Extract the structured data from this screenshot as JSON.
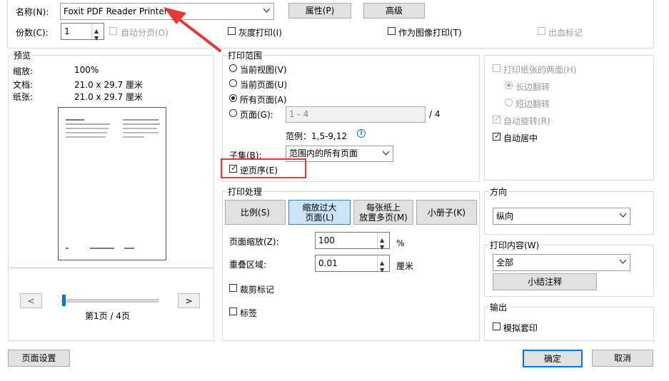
{
  "printer": {
    "name_label": "名称(N):",
    "name_value": "Foxit PDF Reader Printer",
    "properties_button": "属性(P)",
    "advanced_button": "高级",
    "copies_label": "份数(C):",
    "copies_value": "1",
    "collate_label": "自动分页(O)",
    "grayscale_label": "灰度打印(I)",
    "as_image_label": "作为图像打印(T)",
    "bleed_label": "出血标记"
  },
  "preview": {
    "title": "预览",
    "zoom_label": "缩放:",
    "zoom_value": "100%",
    "document_label": "文档:",
    "document_value": "21.0 x 29.7 厘米",
    "paper_label": "纸张:",
    "paper_value": "21.0 x 29.7 厘米",
    "prev_button": "<",
    "next_button": ">",
    "page_indicator": "第1页 / 4页"
  },
  "range": {
    "title": "打印范围",
    "current_view": "当前视图(V)",
    "current_page": "当前页面(U)",
    "all_pages": "所有页面(A)",
    "pages": "页面(G):",
    "pages_value": "1 - 4",
    "total": "/ 4",
    "example": "范例：1,5-9,12",
    "info_icon": "i",
    "subset_label": "子集(B):",
    "subset_value": "范围内的所有页面",
    "reverse_label": "逆页序(E)"
  },
  "duplex": {
    "both_sides": "打印纸张的两面(H)",
    "long_edge": "长边翻转",
    "short_edge": "短边翻转",
    "auto_rotate": "自动旋转(R)",
    "auto_center": "自动居中"
  },
  "handling": {
    "title": "打印处理",
    "tab_scale": "比例(S)",
    "tab_fit_line1": "缩放过大",
    "tab_fit_line2": "页面(L)",
    "tab_multi_line1": "每张纸上",
    "tab_multi_line2": "放置多页(M)",
    "tab_booklet": "小册子(K)",
    "scale_label": "页面缩放(Z):",
    "scale_value": "100",
    "scale_unit": "%",
    "overlap_label": "重叠区域:",
    "overlap_value": "0.01",
    "overlap_unit": "厘米",
    "crop_marks": "裁剪标记",
    "labels": "标签"
  },
  "orientation": {
    "title": "方向",
    "value": "纵向"
  },
  "content": {
    "title": "打印内容(W)",
    "value": "全部",
    "summarize_button": "小结注释"
  },
  "output": {
    "title": "输出",
    "simulate_overprint": "模拟套印"
  },
  "footer": {
    "page_setup": "页面设置",
    "ok": "确定",
    "cancel": "取消"
  },
  "colors": {
    "annotation_red": "#e53935",
    "accent_blue": "#0078d7"
  }
}
